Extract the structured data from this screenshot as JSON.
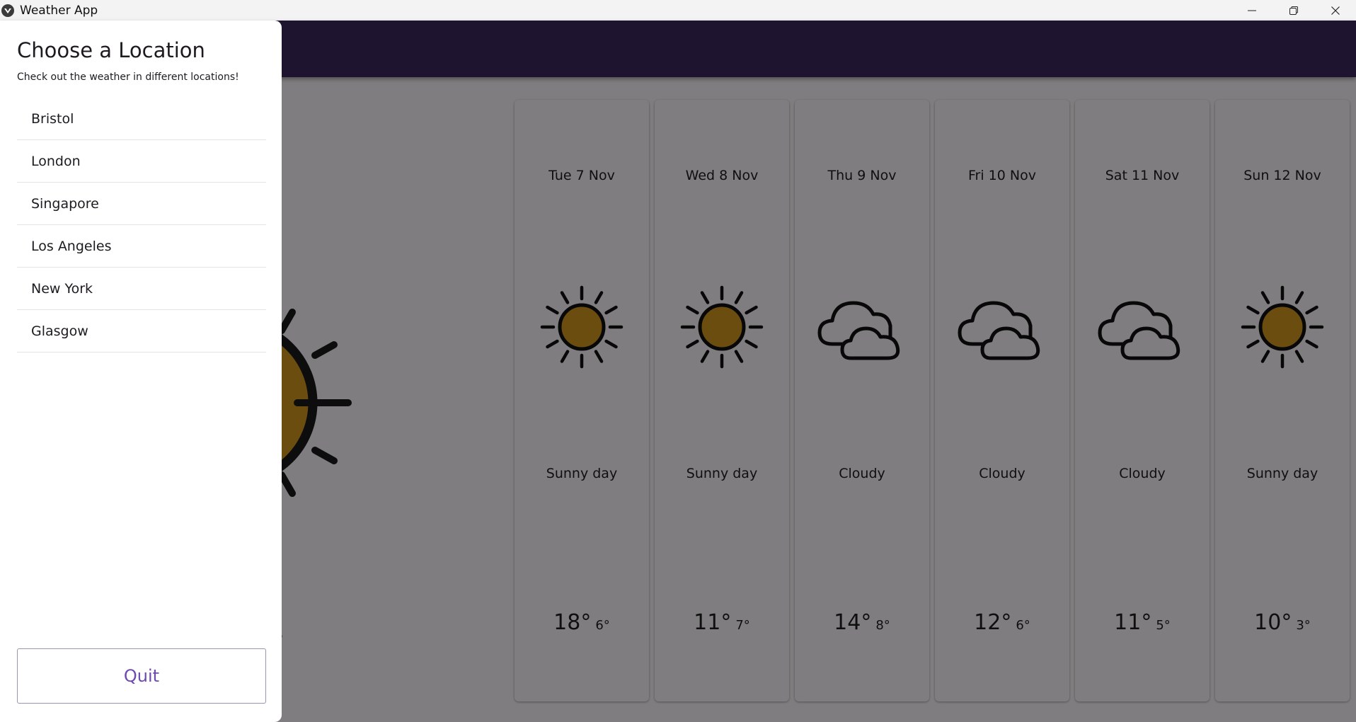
{
  "window": {
    "title": "Weather App",
    "controls": [
      "minimize-icon",
      "restore-icon",
      "close-icon"
    ]
  },
  "theme": {
    "appbar_color": "#3c285f",
    "accent": "#6c4ab0",
    "sun_fill": "#d69a21",
    "scrim": "rgba(0,0,0,0.5)"
  },
  "today": {
    "day_fragment": "ay",
    "temp_fragment": "°",
    "icon": "sun-icon"
  },
  "forecast": [
    {
      "date": "Tue 7 Nov",
      "condition": "Sunny day",
      "icon": "sun-icon",
      "high": "18°",
      "low": "6°"
    },
    {
      "date": "Wed 8 Nov",
      "condition": "Sunny day",
      "icon": "sun-icon",
      "high": "11°",
      "low": "7°"
    },
    {
      "date": "Thu 9 Nov",
      "condition": "Cloudy",
      "icon": "cloud-icon",
      "high": "14°",
      "low": "8°"
    },
    {
      "date": "Fri 10 Nov",
      "condition": "Cloudy",
      "icon": "cloud-icon",
      "high": "12°",
      "low": "6°"
    },
    {
      "date": "Sat 11 Nov",
      "condition": "Cloudy",
      "icon": "cloud-icon",
      "high": "11°",
      "low": "5°"
    },
    {
      "date": "Sun 12 Nov",
      "condition": "Sunny day",
      "icon": "sun-icon",
      "high": "10°",
      "low": "3°"
    }
  ],
  "drawer": {
    "title": "Choose a Location",
    "subtitle": "Check out the weather in different locations!",
    "locations": [
      "Bristol",
      "London",
      "Singapore",
      "Los Angeles",
      "New York",
      "Glasgow"
    ],
    "quit_label": "Quit"
  }
}
